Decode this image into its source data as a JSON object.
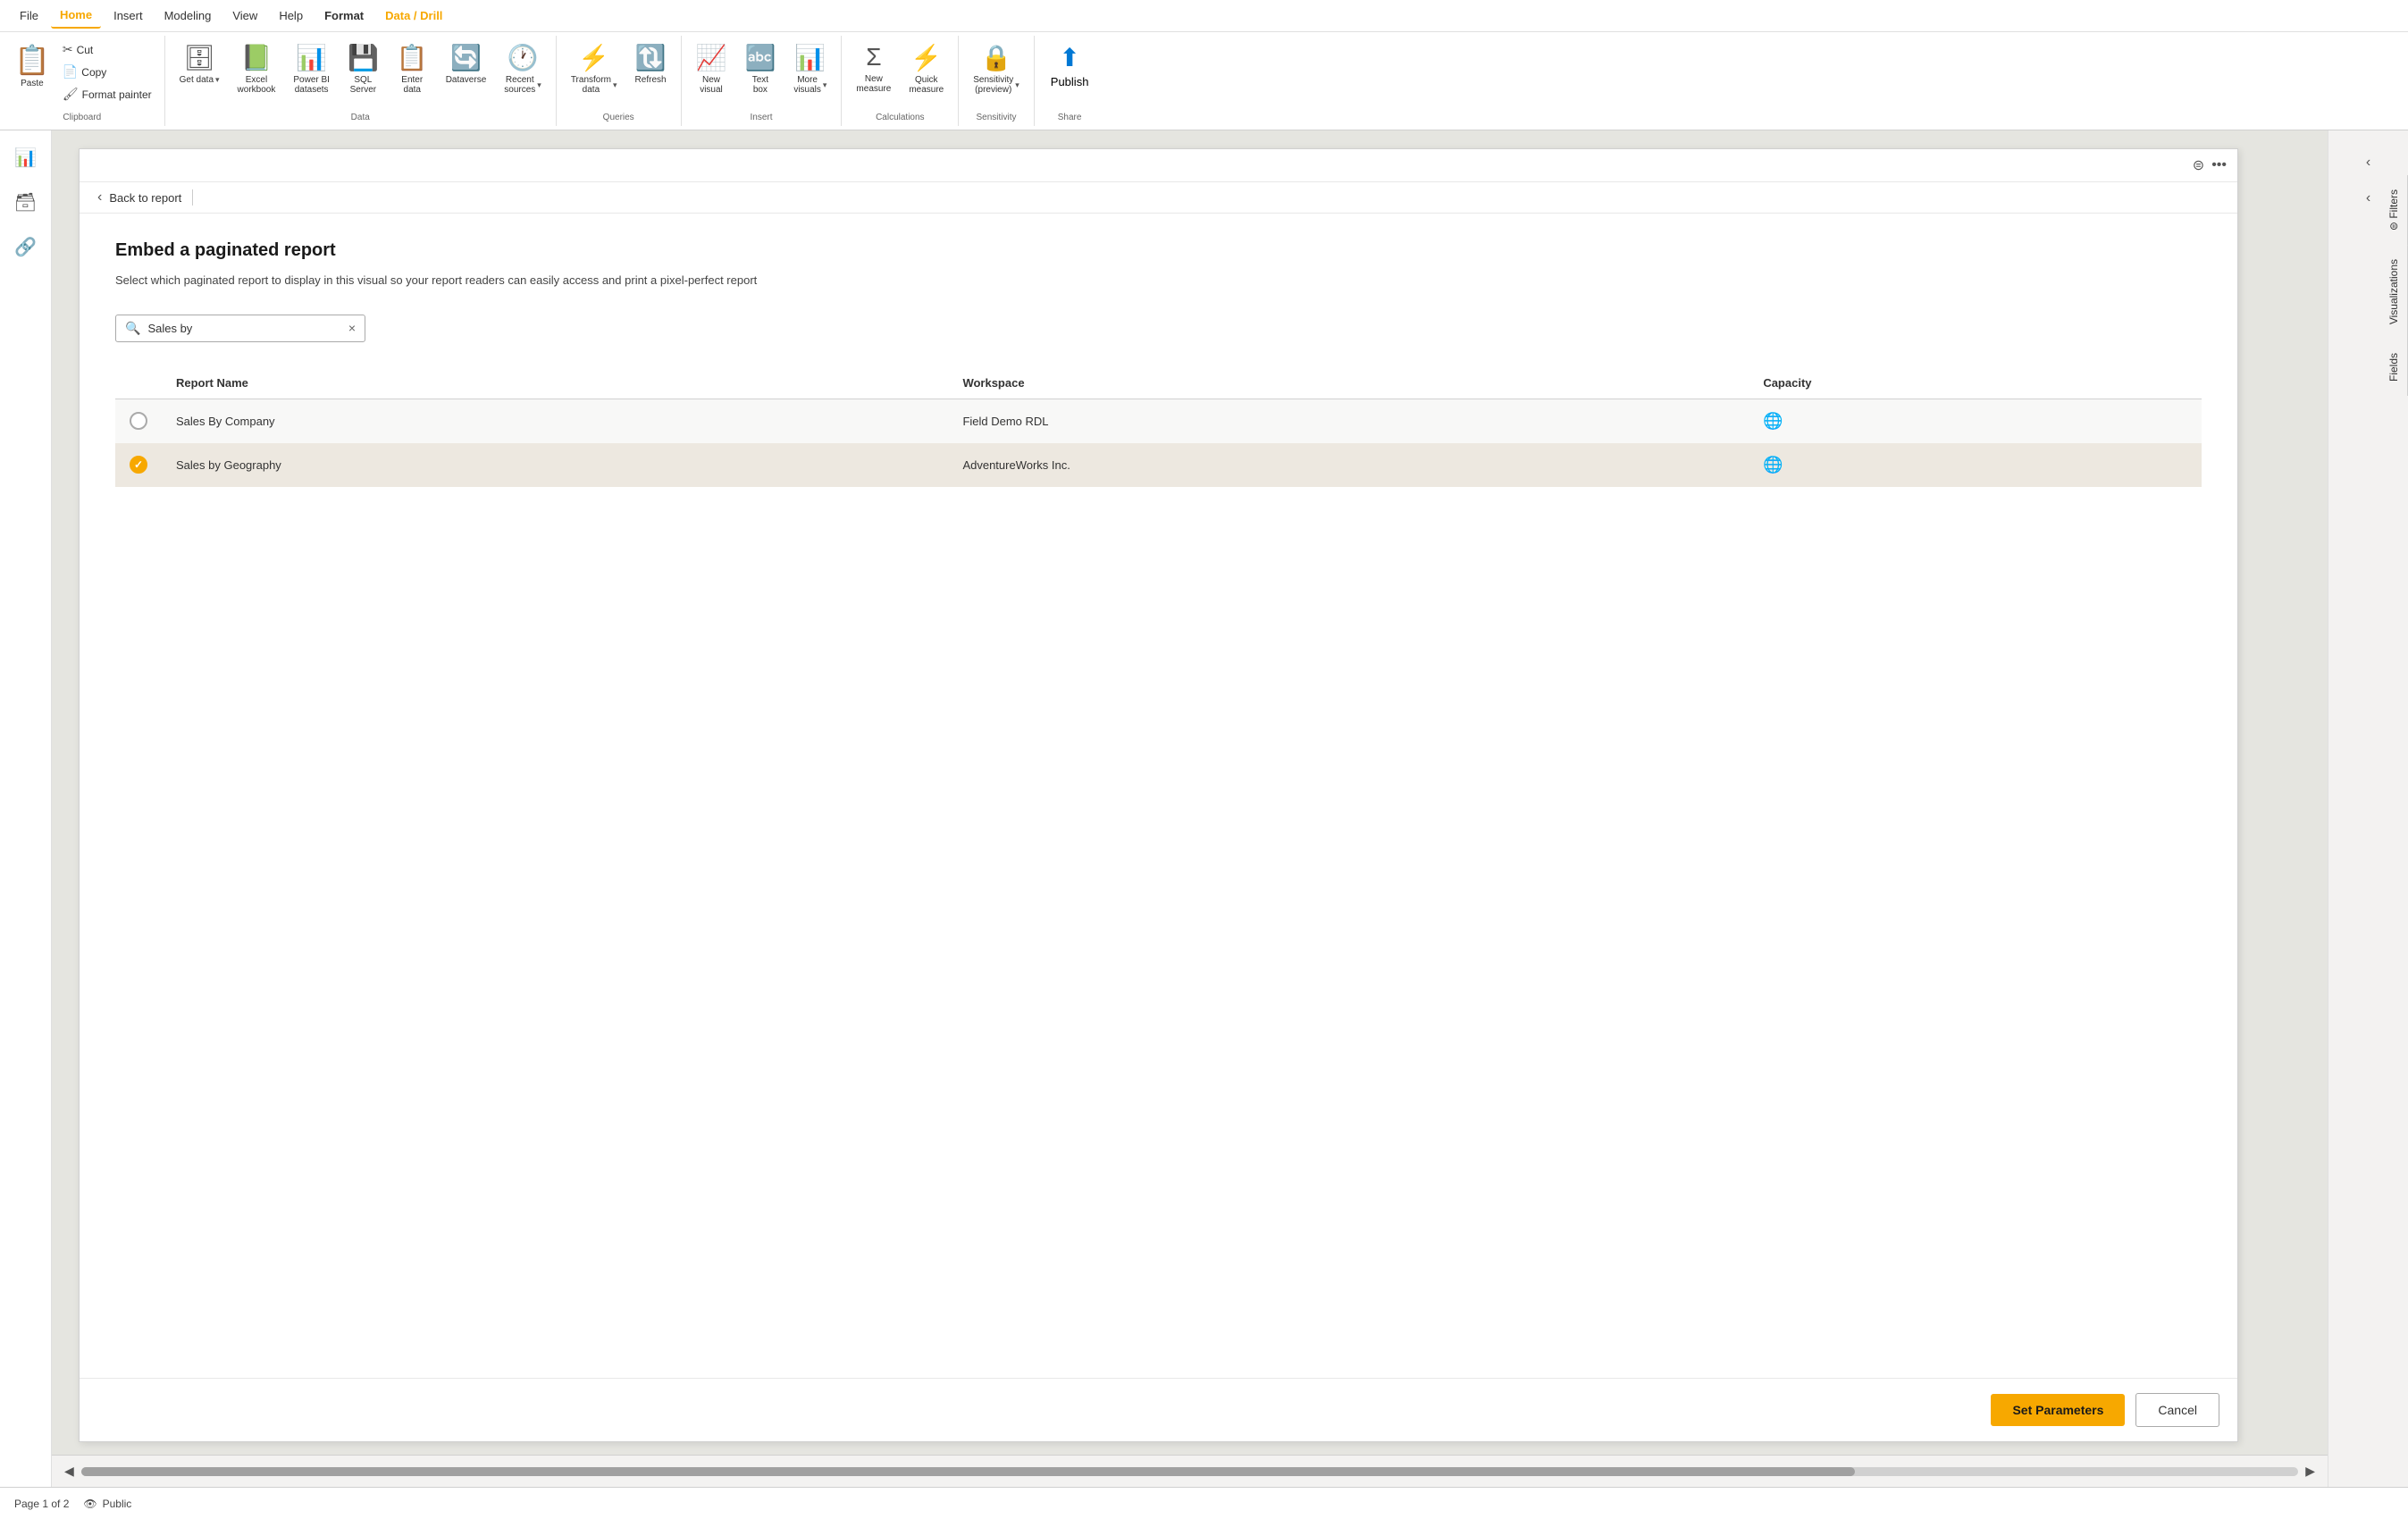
{
  "menu": {
    "items": [
      {
        "id": "file",
        "label": "File",
        "active": false
      },
      {
        "id": "home",
        "label": "Home",
        "active": true
      },
      {
        "id": "insert",
        "label": "Insert",
        "active": false
      },
      {
        "id": "modeling",
        "label": "Modeling",
        "active": false
      },
      {
        "id": "view",
        "label": "View",
        "active": false
      },
      {
        "id": "help",
        "label": "Help",
        "active": false
      },
      {
        "id": "format",
        "label": "Format",
        "active": false
      },
      {
        "id": "datadrill",
        "label": "Data / Drill",
        "active": true
      }
    ]
  },
  "ribbon": {
    "groups": [
      {
        "id": "clipboard",
        "label": "Clipboard",
        "buttons": {
          "paste": "Paste",
          "cut": "Cut",
          "copy": "Copy",
          "format_painter": "Format painter"
        }
      },
      {
        "id": "data",
        "label": "Data",
        "buttons": [
          {
            "id": "get_data",
            "label": "Get data",
            "icon": "🗄",
            "hasDropdown": true
          },
          {
            "id": "excel",
            "label": "Excel workbook",
            "icon": "📗",
            "hasDropdown": false
          },
          {
            "id": "powerbi",
            "label": "Power BI datasets",
            "icon": "📊",
            "hasDropdown": false
          },
          {
            "id": "sql",
            "label": "SQL Server",
            "icon": "💾",
            "hasDropdown": false
          },
          {
            "id": "enter",
            "label": "Enter data",
            "icon": "📋",
            "hasDropdown": false
          },
          {
            "id": "dataverse",
            "label": "Dataverse",
            "icon": "🔄",
            "hasDropdown": false
          },
          {
            "id": "recent",
            "label": "Recent sources",
            "icon": "🕐",
            "hasDropdown": true
          }
        ]
      },
      {
        "id": "queries",
        "label": "Queries",
        "buttons": [
          {
            "id": "transform",
            "label": "Transform data",
            "icon": "⚡",
            "hasDropdown": true
          },
          {
            "id": "refresh",
            "label": "Refresh",
            "icon": "🔄",
            "hasDropdown": false
          }
        ]
      },
      {
        "id": "insert",
        "label": "Insert",
        "buttons": [
          {
            "id": "new_visual",
            "label": "New visual",
            "icon": "📈",
            "hasDropdown": false
          },
          {
            "id": "text_box",
            "label": "Text box",
            "icon": "🔤",
            "hasDropdown": false
          },
          {
            "id": "more_visuals",
            "label": "More visuals",
            "icon": "📊",
            "hasDropdown": true
          }
        ]
      },
      {
        "id": "calculations",
        "label": "Calculations",
        "buttons": [
          {
            "id": "new_measure",
            "label": "New measure",
            "icon": "Σ",
            "hasDropdown": false
          },
          {
            "id": "quick_measure",
            "label": "Quick measure",
            "icon": "⚡",
            "hasDropdown": false
          }
        ]
      },
      {
        "id": "sensitivity",
        "label": "Sensitivity",
        "buttons": [
          {
            "id": "sensitivity",
            "label": "Sensitivity (preview)",
            "icon": "🔒",
            "hasDropdown": true
          }
        ]
      },
      {
        "id": "share",
        "label": "Share",
        "buttons": [
          {
            "id": "publish",
            "label": "Publish",
            "icon": "⬆",
            "hasDropdown": false
          }
        ]
      }
    ]
  },
  "left_panel": {
    "icons": [
      {
        "id": "report",
        "icon": "📊",
        "active": false
      },
      {
        "id": "data",
        "icon": "🗃",
        "active": false
      },
      {
        "id": "model",
        "icon": "🔗",
        "active": false
      }
    ]
  },
  "modal": {
    "back_label": "Back to report",
    "header_icons": [
      "🔍",
      "..."
    ],
    "title": "Embed a paginated report",
    "description": "Select which paginated report to display in this visual so your report readers can easily access and print a pixel-perfect report",
    "search": {
      "placeholder": "Search",
      "value": "Sales by",
      "clear_icon": "×"
    },
    "table": {
      "columns": [
        "Report Name",
        "Workspace",
        "Capacity"
      ],
      "rows": [
        {
          "id": "row1",
          "selected": false,
          "report_name": "Sales By Company",
          "workspace": "Field Demo RDL",
          "capacity_icon": "🌐"
        },
        {
          "id": "row2",
          "selected": true,
          "report_name": "Sales by Geography",
          "workspace": "AdventureWorks Inc.",
          "capacity_icon": "🌐"
        }
      ]
    },
    "buttons": {
      "set_params": "Set Parameters",
      "cancel": "Cancel"
    }
  },
  "right_panel": {
    "tabs": [
      {
        "id": "filters",
        "label": "Filters"
      },
      {
        "id": "visualizations",
        "label": "Visualizations"
      },
      {
        "id": "fields",
        "label": "Fields"
      }
    ],
    "nav_buttons": [
      "‹",
      "‹"
    ]
  },
  "status_bar": {
    "page": "Page 1 of 2",
    "visibility_icon": "👁",
    "visibility_label": "Public"
  },
  "colors": {
    "accent": "#f7a800",
    "blue": "#0078d4",
    "green": "#107c10",
    "gold": "#f7a800"
  }
}
